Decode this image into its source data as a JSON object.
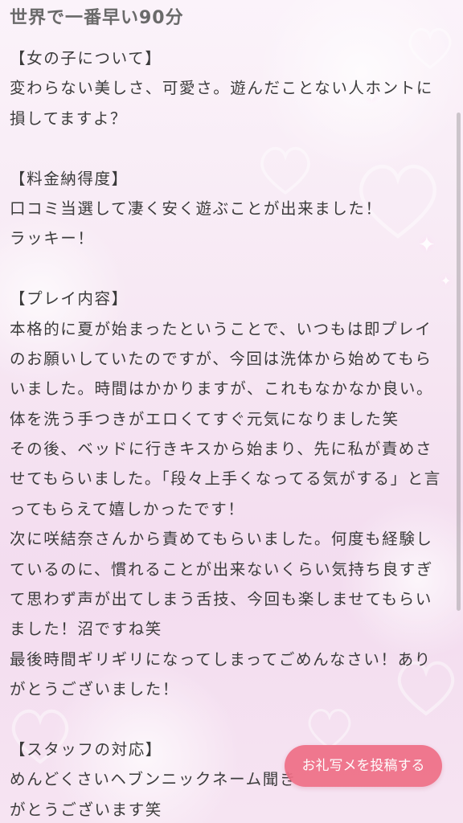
{
  "page": {
    "title": "世界で一番早い90分",
    "lines": [
      "【女の子について】",
      "変わらない美しさ、可愛さ。遊んだことない人ホントに",
      "損してますよ？",
      "",
      "【料金納得度】",
      "口コミ当選して凄く安く遊ぶことが出来ました！",
      "ラッキー！",
      "",
      "【プレイ内容】",
      "本格的に夏が始まったということで、いつもは即プレイ",
      "のお願いしていたのですが、今回は洗体から始めてもら",
      "いました。時間はかかりますが、これもなかなか良い。",
      "体を洗う手つきがエロくてすぐ元気になりました笑",
      "その後、ベッドに行きキスから始まり、先に私が責めさ",
      "せてもらいました。「段々上手くなってる気がする」と言",
      "ってもらえて嬉しかったです！",
      "次に咲結奈さんから責めてもらいました。何度も経験し",
      "ているのに、慣れることが出来ないくらい気持ち良すぎ",
      "て思わず声が出てしまう舌技、今回も楽しませてもらい",
      "ました！沼ですね笑",
      "最後時間ギリギリになってしまってごめんなさい！あり",
      "がとうございました！",
      "",
      "【スタッフの対応】",
      "めんどくさいヘブンニックネーム聞き",
      "がとうございます笑"
    ]
  },
  "cta": {
    "label": "お礼写メを投稿する"
  },
  "theme": {
    "accent": "#ef6f86",
    "heart_color": "#ffffff",
    "background": "#f7e9f4"
  }
}
